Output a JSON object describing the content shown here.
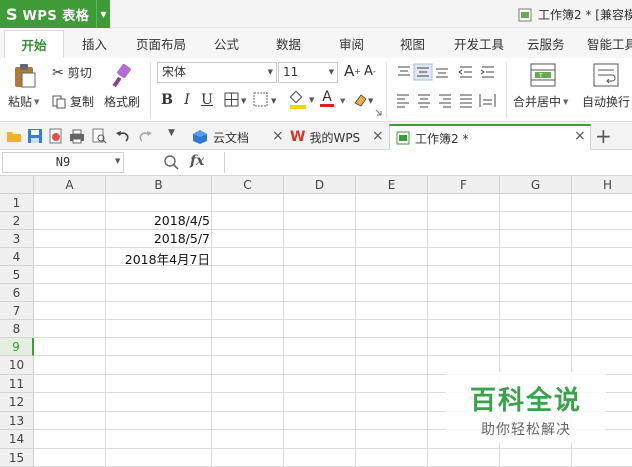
{
  "app": {
    "logo": "S",
    "name": "WPS 表格",
    "window_title": "工作簿2 * [兼容模"
  },
  "menu": {
    "tabs": [
      "开始",
      "插入",
      "页面布局",
      "公式",
      "数据",
      "审阅",
      "视图",
      "开发工具",
      "云服务",
      "智能工具"
    ],
    "active": "开始"
  },
  "ribbon": {
    "paste_label": "粘贴",
    "cut_label": "剪切",
    "copy_label": "复制",
    "format_painter_label": "格式刷",
    "font_name": "宋体",
    "font_size": "11",
    "increase_font": "A",
    "decrease_font": "A",
    "bold": "B",
    "italic": "I",
    "underline": "U",
    "font_color_letter": "A",
    "merge_center_label": "合并居中",
    "wrap_text_label": "自动换行"
  },
  "doc_tabs": [
    {
      "label": "云文档",
      "icon": "cloud-doc-icon"
    },
    {
      "label": "我的WPS",
      "icon": "wps-logo-icon"
    },
    {
      "label": "工作簿2 *",
      "icon": "spreadsheet-icon"
    }
  ],
  "formula_bar": {
    "name_box": "N9",
    "fx": "fx",
    "formula": ""
  },
  "sheet": {
    "columns": [
      "A",
      "B",
      "C",
      "D",
      "E",
      "F",
      "G",
      "H"
    ],
    "rows": [
      "1",
      "2",
      "3",
      "4",
      "5",
      "6",
      "7",
      "8",
      "9",
      "10",
      "11",
      "12",
      "13",
      "14",
      "15"
    ],
    "active_row": "9",
    "cells": {
      "B2": "2018/4/5",
      "B3": "2018/5/7",
      "B4": "2018年4月7日"
    }
  },
  "watermark": {
    "main": "百科全说",
    "sub": "助你轻松解决"
  },
  "colors": {
    "accent": "#3f9b38",
    "watermark_green": "#3aa24a",
    "font_color_red": "#e02020",
    "highlight_yellow": "#f5d300"
  }
}
